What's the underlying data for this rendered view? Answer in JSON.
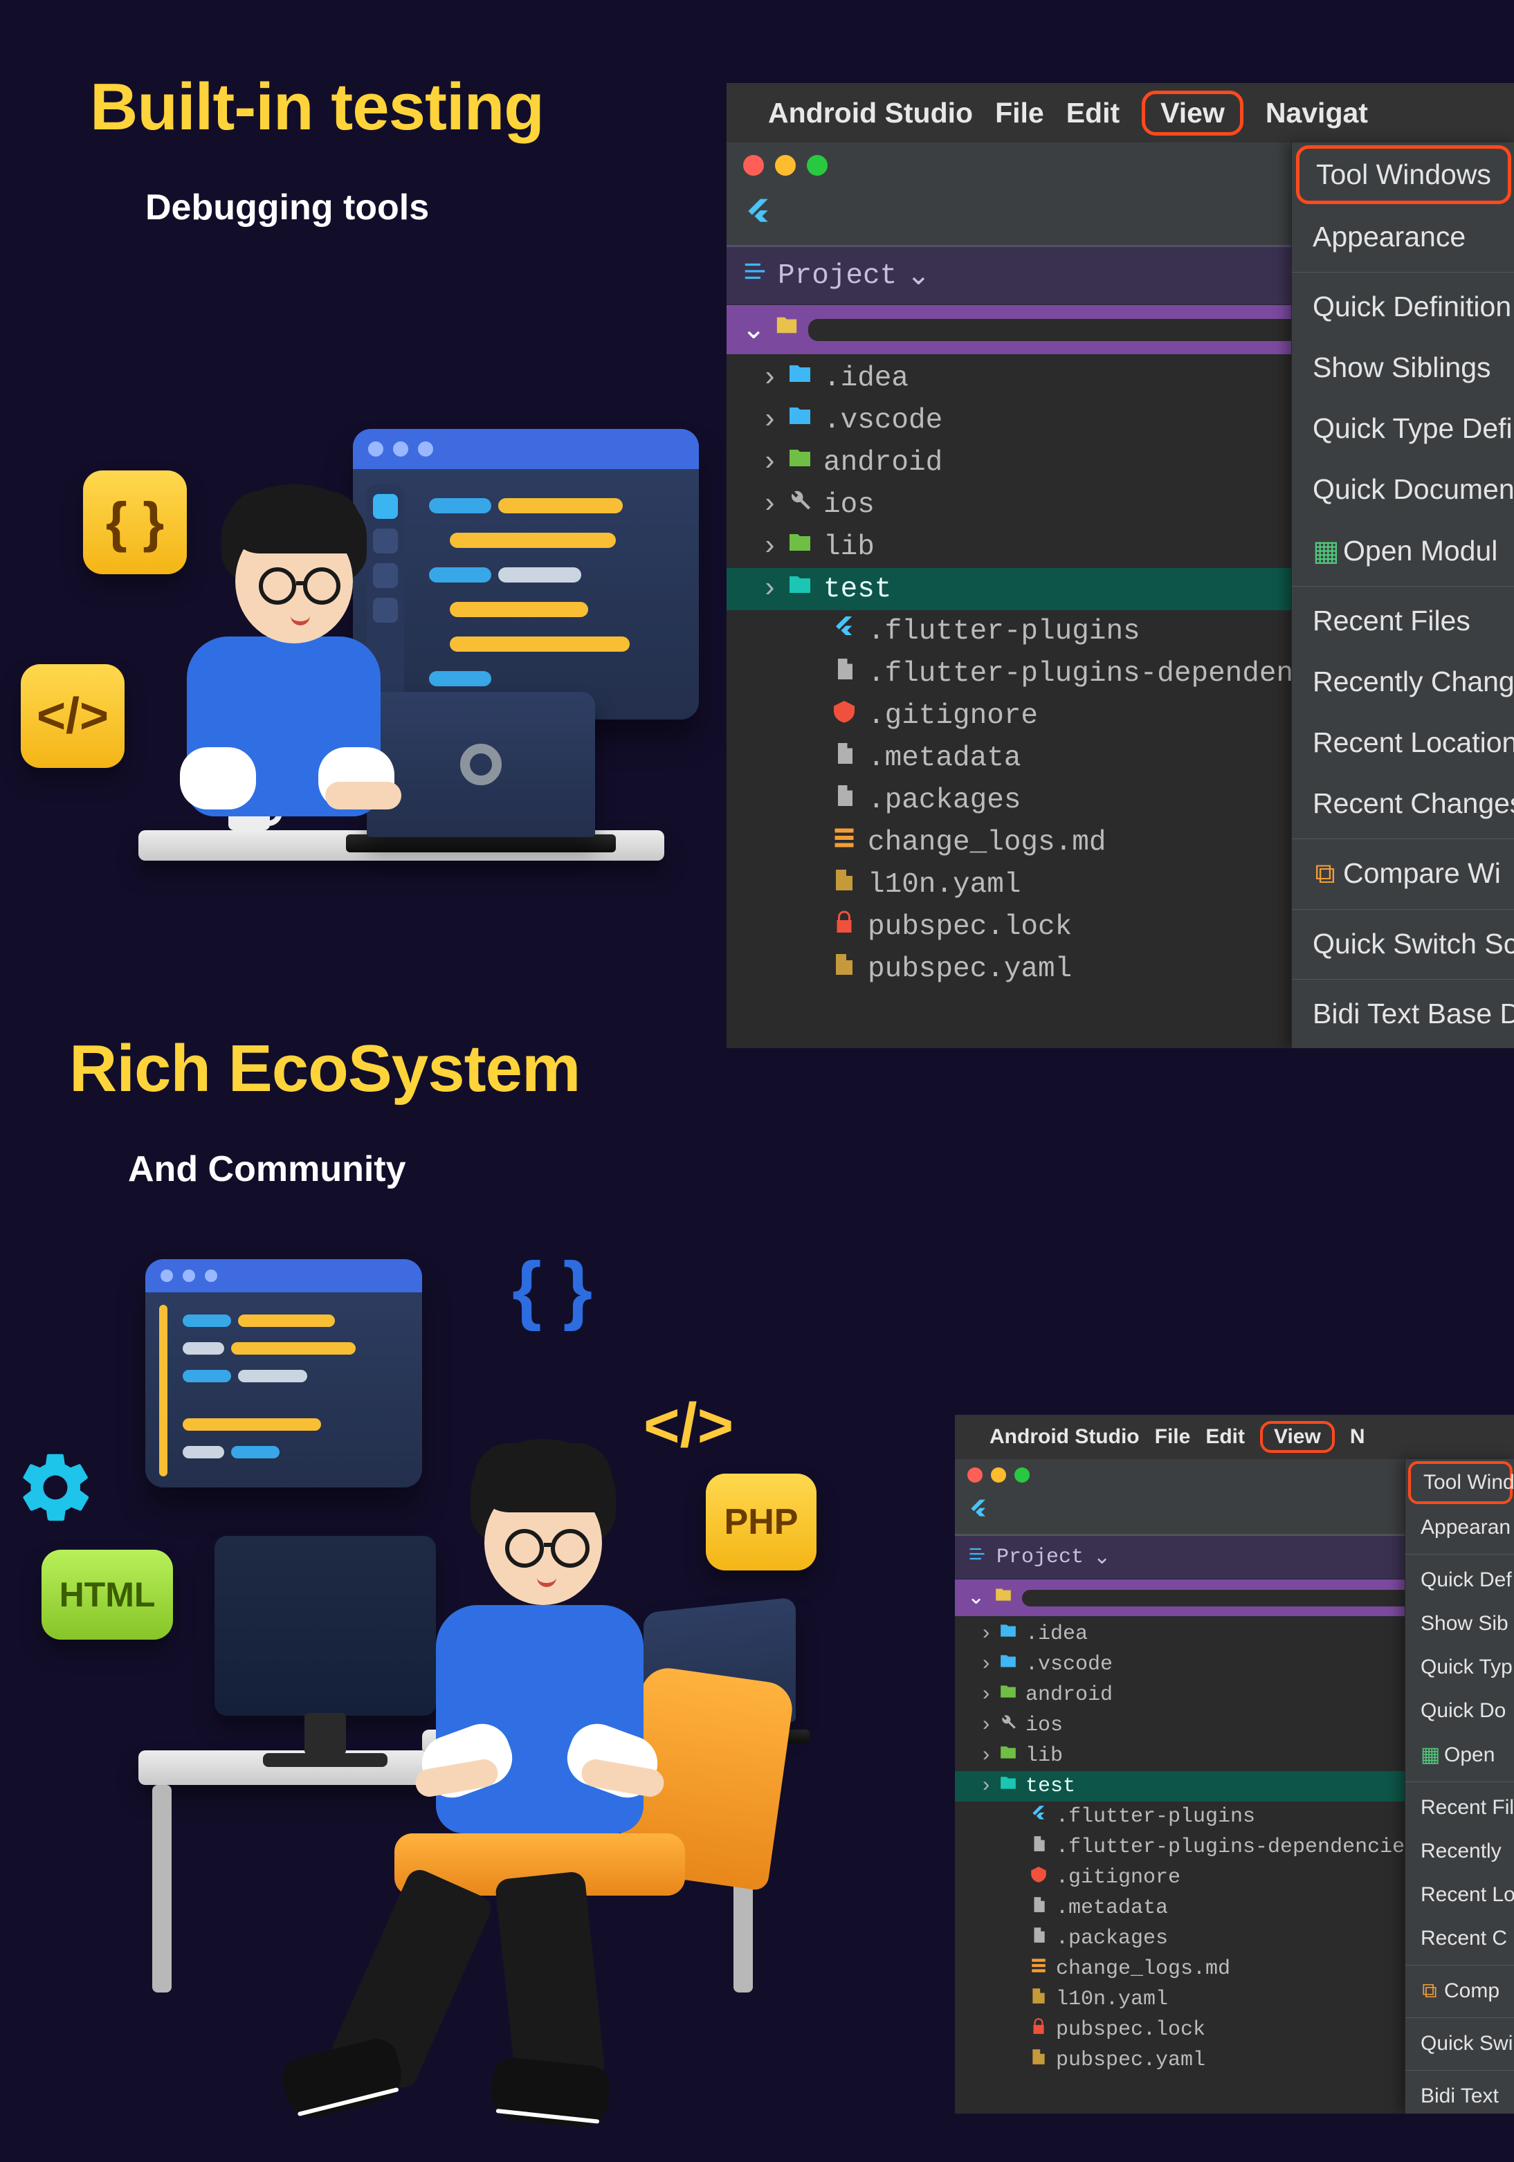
{
  "sections": [
    {
      "title": "Built-in testing",
      "subtitle": "Debugging tools"
    },
    {
      "title": "Rich EcoSystem",
      "subtitle": "And Community"
    }
  ],
  "badges": {
    "html": "HTML",
    "php": "PHP"
  },
  "studio": {
    "app_name": "Android Studio",
    "menubar": [
      "File",
      "Edit",
      "View",
      "Navigat",
      "N"
    ],
    "project_label": "Project",
    "tree": [
      {
        "type": "folder",
        "cls": "folder-blue",
        "label": ".idea",
        "chev": true
      },
      {
        "type": "folder",
        "cls": "folder-blue",
        "label": ".vscode",
        "chev": true
      },
      {
        "type": "folder",
        "cls": "folder-green",
        "label": "android",
        "chev": true
      },
      {
        "type": "wrench",
        "cls": "wrench",
        "label": "ios",
        "chev": true
      },
      {
        "type": "folder",
        "cls": "folder-green",
        "label": "lib",
        "chev": true
      },
      {
        "type": "folder",
        "cls": "folder-teal",
        "label": "test",
        "chev": true,
        "selected": true
      },
      {
        "type": "file",
        "cls": "file-flutter",
        "label": ".flutter-plugins"
      },
      {
        "type": "file",
        "cls": "file-grey",
        "label": ".flutter-plugins-dependencie"
      },
      {
        "type": "file",
        "cls": "file-red",
        "label": ".gitignore"
      },
      {
        "type": "file",
        "cls": "file-grey",
        "label": ".metadata"
      },
      {
        "type": "file",
        "cls": "file-grey",
        "label": ".packages"
      },
      {
        "type": "file",
        "cls": "file-orange",
        "label": "change_logs.md"
      },
      {
        "type": "file",
        "cls": "file-yaml",
        "label": "l10n.yaml"
      },
      {
        "type": "file",
        "cls": "file-lock",
        "label": "pubspec.lock"
      },
      {
        "type": "file",
        "cls": "file-yaml",
        "label": "pubspec.yaml"
      }
    ],
    "dropdown": [
      {
        "label": "Tool Windows",
        "hi": true
      },
      {
        "label": "Appearance"
      },
      {
        "sep": true
      },
      {
        "label": "Quick Definition"
      },
      {
        "label": "Show Siblings"
      },
      {
        "label": "Quick Type Defi"
      },
      {
        "label": "Quick Documen"
      },
      {
        "label": "Open Modul",
        "icon": "green"
      },
      {
        "sep": true
      },
      {
        "label": "Recent Files"
      },
      {
        "label": "Recently Chang"
      },
      {
        "label": "Recent Location"
      },
      {
        "label": "Recent Changes"
      },
      {
        "sep": true
      },
      {
        "label": "Compare Wi",
        "icon": "orange"
      },
      {
        "sep": true
      },
      {
        "label": "Quick Switch Sc"
      },
      {
        "sep": true
      },
      {
        "label": "Bidi Text Base D"
      }
    ],
    "dropdown2_labels": [
      "Tool Wind",
      "Appearan",
      "Quick Def",
      "Show Sib",
      "Quick Typ",
      "Quick Do",
      "Open",
      "Recent Fil",
      "Recently",
      "Recent Lo",
      "Recent C",
      "Comp",
      "Quick Swi",
      "Bidi Text"
    ]
  }
}
